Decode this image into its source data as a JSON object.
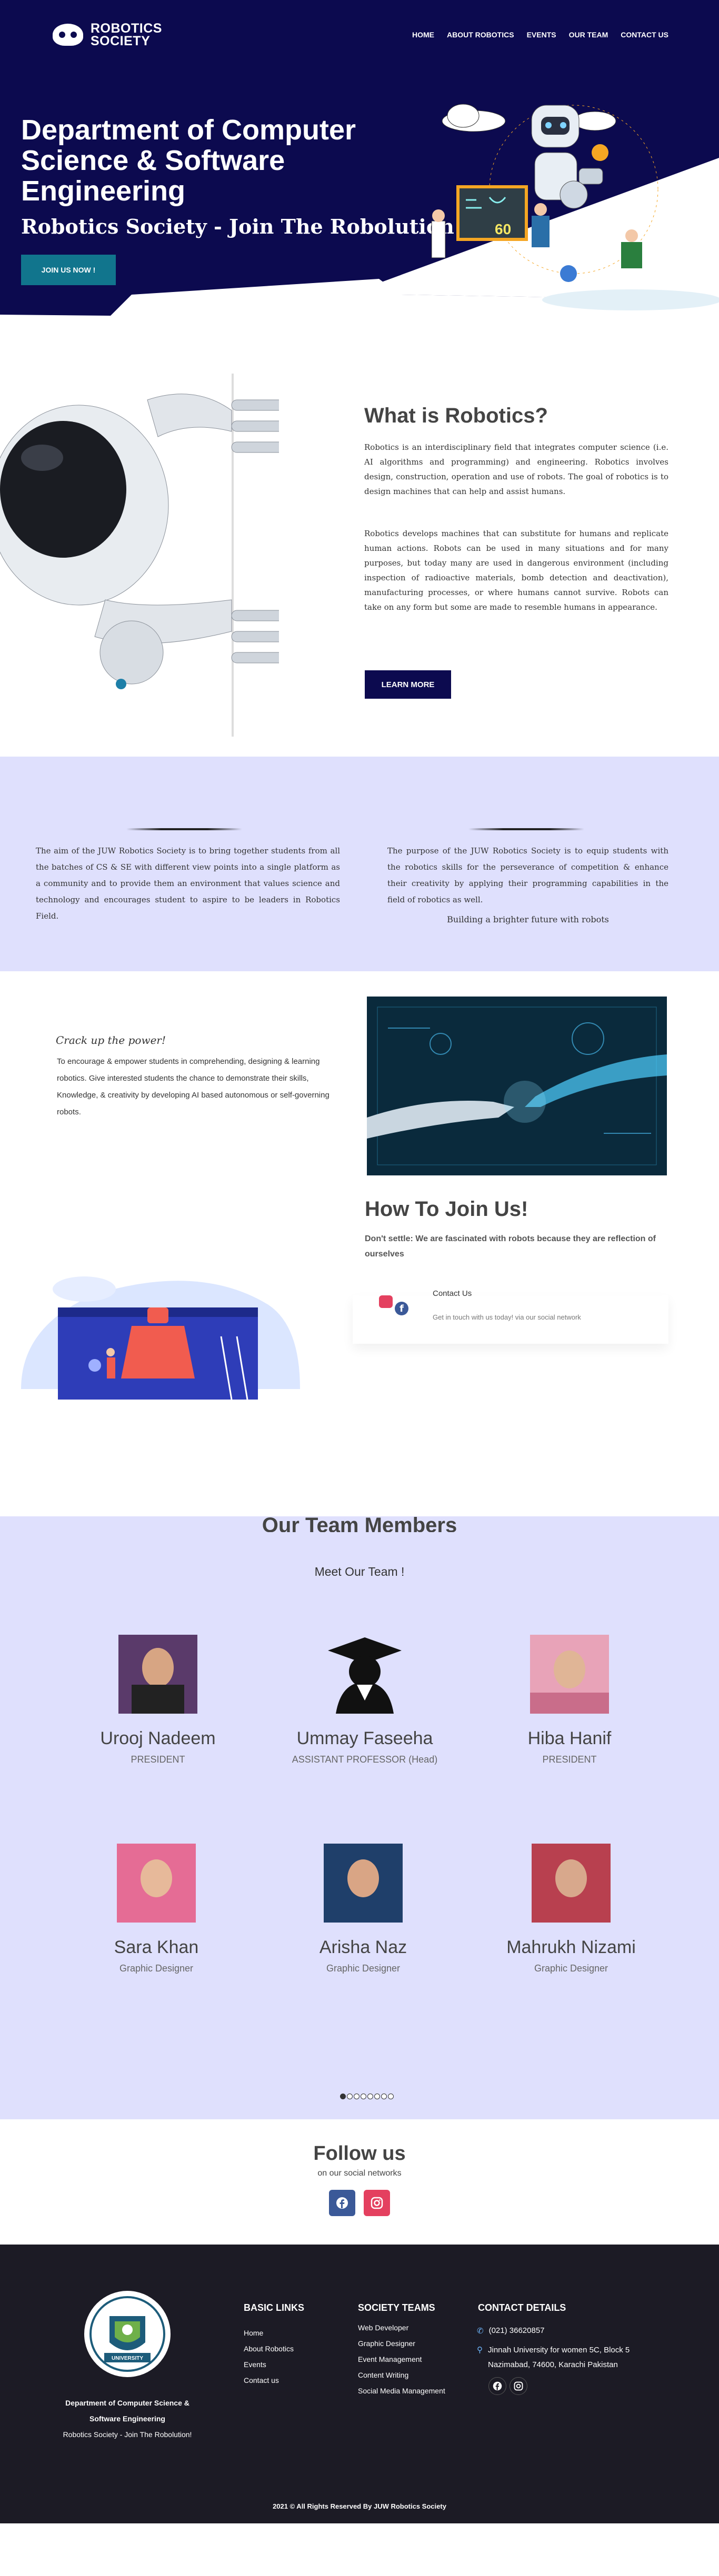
{
  "brand": {
    "line1": "ROBOTICS",
    "line2": "SOCIETY"
  },
  "nav": [
    "HOME",
    "ABOUT ROBOTICS",
    "EVENTS",
    "OUR TEAM",
    "CONTACT US"
  ],
  "hero": {
    "title": "Department of Computer Science & Software Engineering",
    "subtitle": "Robotics Society - Join The Robolution",
    "button": "JOIN US NOW !",
    "board_number": "60"
  },
  "about": {
    "title": "What is Robotics?",
    "p1": "Robotics is an interdisciplinary field that integrates computer science (i.e. AI algorithms and programming) and engineering. Robotics involves design, construction, operation and use of robots. The goal of robotics is to design machines that can help and assist humans.",
    "p2": "Robotics develops machines that can substitute for humans and replicate human actions. Robots can be used in many situations and for many purposes, but today many are used in dangerous environment (including inspection of radioactive materials, bomb detection and deactivation), manufacturing processes, or where humans cannot survive. Robots can take on any form but some are made to resemble humans in appearance.",
    "button": "LEARN MORE"
  },
  "aims": {
    "left": "The aim of the JUW Robotics Society is to bring together students from all the batches of CS & SE with different view points into a single platform as a community and to provide them an environment that values science and technology and encourages student to aspire to be leaders in Robotics Field.",
    "right": "The purpose of the JUW Robotics Society is to equip students with the robotics skills for the perseverance of competition & enhance their creativity by applying their programming capabilities in the field of robotics as well.",
    "tagline": "Building a brighter future with robots"
  },
  "crack": {
    "title": "Crack up the power!",
    "text": "To encourage & empower students in comprehending, designing & learning robotics. Give interested students the chance to demonstrate their skills, Knowledge, & creativity by developing AI based autonomous or self-governing robots."
  },
  "join": {
    "title": "How To Join Us!",
    "text": "Don't settle: We are fascinated with robots because they are reflection of ourselves",
    "card_title": "Contact Us",
    "card_text": "Get in touch with us today! via our social network"
  },
  "team": {
    "title": "Our Team Members",
    "subtitle": "Meet Our Team !",
    "members": [
      {
        "name": "Urooj Nadeem",
        "role": "PRESIDENT"
      },
      {
        "name": "Ummay Faseeha",
        "role": "ASSISTANT PROFESSOR (Head)"
      },
      {
        "name": "Hiba Hanif",
        "role": "PRESIDENT"
      },
      {
        "name": "Sara Khan",
        "role": "Graphic Designer"
      },
      {
        "name": "Arisha Naz",
        "role": "Graphic Designer"
      },
      {
        "name": "Mahrukh Nizami",
        "role": "Graphic Designer"
      }
    ]
  },
  "follow": {
    "title": "Follow us",
    "subtitle": "on our social networks"
  },
  "footer": {
    "org_line1": "Department of Computer Science &",
    "org_line2": "Software Engineering",
    "org_tag": "Robotics Society - Join The Robolution!",
    "seal_text": "UNIVERSITY",
    "basic_title": "BASIC LINKS",
    "basic_links": [
      "Home",
      "About Robotics",
      "Events",
      "Contact us"
    ],
    "teams_title": "SOCIETY TEAMS",
    "teams": [
      "Web Developer",
      "Graphic Designer",
      "Event Management",
      "Content Writing",
      "Social Media Management"
    ],
    "contact_title": "CONTACT DETAILS",
    "phone": "(021) 36620857",
    "address": "Jinnah University for women 5C, Block 5 Nazimabad, 74600, Karachi Pakistan",
    "copyright": "2021 © All Rights Reserved By JUW Robotics Society"
  },
  "colors": {
    "navy": "#0c0a4f",
    "teal": "#11758d",
    "lavender": "#dfe0fd",
    "footer": "#1c1b25",
    "facebook": "#3b5998",
    "instagram": "#e4405f"
  }
}
